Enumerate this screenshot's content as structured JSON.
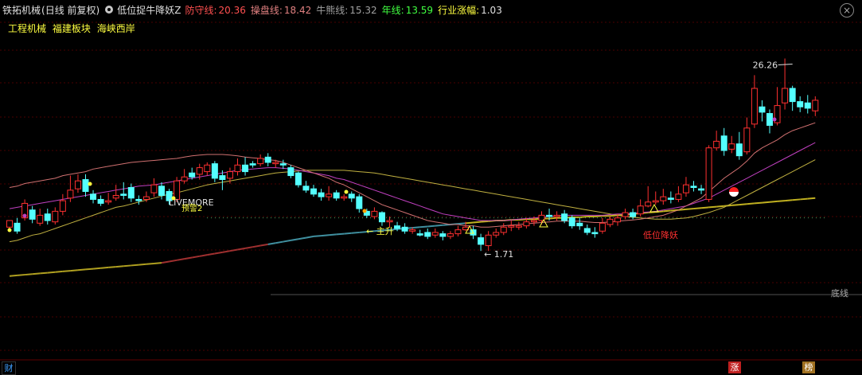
{
  "header": {
    "stock_name": "铁拓机械",
    "period": "(日线 前复权)",
    "indicator_name": "低位捉牛降妖Z",
    "items": [
      {
        "label": "防守线:",
        "value": "20.36",
        "color": "#ff5050"
      },
      {
        "label": "操盘线:",
        "value": "18.42",
        "color": "#e08080"
      },
      {
        "label": "牛熊线:",
        "value": "15.32",
        "color": "#a0a0a0"
      },
      {
        "label": "年线:",
        "value": "13.59",
        "color": "#40ff40"
      },
      {
        "label": "行业涨幅:",
        "value": "1.03",
        "color": "#ffff40"
      }
    ]
  },
  "tags": [
    "工程机械",
    "福建板块",
    "海峡西岸"
  ],
  "chart_data": {
    "type": "candlestick",
    "ylim": [
      9,
      29
    ],
    "max_label": "26.26",
    "min_label": "1.71",
    "candles": [
      [
        13.5,
        14.0,
        14.0,
        13.2
      ],
      [
        13.8,
        13.2,
        14.2,
        13.0
      ],
      [
        14.2,
        15.3,
        15.6,
        14.0
      ],
      [
        14.8,
        14.1,
        15.1,
        13.8
      ],
      [
        13.8,
        14.4,
        14.9,
        13.6
      ],
      [
        14.5,
        14.0,
        14.9,
        13.7
      ],
      [
        13.9,
        14.7,
        15.0,
        13.7
      ],
      [
        14.7,
        15.5,
        16.0,
        14.4
      ],
      [
        15.7,
        16.3,
        17.4,
        15.4
      ],
      [
        16.4,
        17.0,
        17.5,
        16.1
      ],
      [
        17.1,
        16.2,
        17.5,
        15.8
      ],
      [
        16.0,
        15.6,
        16.3,
        15.3
      ],
      [
        15.6,
        15.3,
        15.9,
        15.1
      ],
      [
        15.4,
        15.5,
        16.1,
        15.2
      ],
      [
        15.7,
        15.9,
        16.7,
        15.5
      ],
      [
        16.0,
        15.9,
        16.9,
        15.6
      ],
      [
        16.5,
        15.7,
        16.8,
        15.4
      ],
      [
        15.6,
        15.5,
        15.9,
        15.2
      ],
      [
        15.6,
        15.8,
        16.2,
        15.4
      ],
      [
        16.1,
        16.7,
        17.2,
        15.8
      ],
      [
        16.6,
        15.9,
        16.9,
        15.6
      ],
      [
        16.2,
        15.5,
        16.4,
        15.2
      ],
      [
        15.6,
        17.0,
        17.3,
        15.4
      ],
      [
        17.0,
        17.3,
        17.9,
        16.8
      ],
      [
        17.6,
        17.3,
        18.0,
        17.1
      ],
      [
        17.5,
        18.0,
        18.3,
        17.1
      ],
      [
        17.7,
        18.2,
        18.4,
        17.4
      ],
      [
        18.3,
        17.2,
        18.5,
        16.9
      ],
      [
        17.4,
        17.1,
        17.8,
        16.3
      ],
      [
        17.2,
        17.7,
        18.0,
        16.8
      ],
      [
        17.7,
        18.2,
        18.7,
        17.4
      ],
      [
        18.2,
        17.7,
        18.8,
        17.4
      ],
      [
        18.3,
        18.2,
        18.5,
        18.0
      ],
      [
        18.3,
        18.7,
        19.0,
        18.1
      ],
      [
        18.8,
        18.4,
        19.1,
        18.1
      ],
      [
        18.3,
        18.4,
        18.6,
        18.0
      ],
      [
        18.3,
        18.2,
        18.6,
        17.9
      ],
      [
        18.0,
        17.4,
        18.2,
        17.2
      ],
      [
        17.6,
        16.7,
        17.7,
        16.5
      ],
      [
        16.6,
        16.3,
        17.0,
        16.1
      ],
      [
        16.4,
        16.0,
        16.7,
        15.8
      ],
      [
        16.1,
        15.8,
        16.4,
        15.5
      ],
      [
        15.8,
        16.0,
        16.6,
        15.5
      ],
      [
        16.1,
        15.7,
        16.3,
        15.5
      ],
      [
        15.7,
        15.8,
        16.0,
        15.5
      ],
      [
        16.0,
        15.7,
        16.2,
        15.4
      ],
      [
        15.8,
        14.9,
        16.0,
        14.6
      ],
      [
        14.7,
        14.4,
        14.9,
        14.2
      ],
      [
        14.3,
        14.7,
        15.0,
        14.1
      ],
      [
        14.6,
        13.9,
        14.7,
        13.6
      ],
      [
        13.9,
        14.0,
        14.3,
        13.5
      ],
      [
        13.6,
        13.4,
        13.9,
        13.2
      ],
      [
        13.5,
        13.2,
        13.8,
        13.0
      ],
      [
        13.2,
        13.3,
        13.5,
        13.0
      ],
      [
        13.0,
        12.9,
        13.3,
        12.8
      ],
      [
        13.1,
        12.8,
        13.4,
        12.6
      ],
      [
        12.9,
        13.1,
        13.4,
        12.7
      ],
      [
        13.0,
        12.8,
        13.2,
        12.5
      ],
      [
        12.8,
        13.0,
        13.2,
        12.6
      ],
      [
        13.0,
        13.3,
        13.6,
        12.8
      ],
      [
        13.3,
        13.5,
        13.9,
        13.2
      ],
      [
        13.3,
        12.9,
        13.6,
        12.6
      ],
      [
        12.7,
        12.2,
        13.0,
        11.7
      ],
      [
        12.1,
        12.9,
        13.2,
        11.7
      ],
      [
        12.9,
        13.1,
        13.4,
        12.7
      ],
      [
        13.1,
        13.5,
        13.8,
        12.9
      ],
      [
        13.5,
        13.6,
        14.0,
        13.2
      ],
      [
        13.5,
        13.6,
        13.9,
        13.3
      ],
      [
        13.6,
        13.9,
        14.2,
        13.4
      ],
      [
        13.9,
        14.0,
        14.3,
        13.6
      ],
      [
        14.0,
        14.4,
        14.7,
        13.7
      ],
      [
        14.4,
        14.3,
        14.9,
        14.0
      ],
      [
        14.3,
        14.4,
        14.7,
        14.0
      ],
      [
        14.5,
        14.0,
        14.8,
        13.8
      ],
      [
        14.2,
        13.6,
        14.4,
        13.4
      ],
      [
        13.8,
        13.6,
        14.2,
        13.3
      ],
      [
        13.4,
        13.1,
        13.7,
        12.9
      ],
      [
        13.1,
        13.0,
        13.5,
        12.7
      ],
      [
        13.2,
        13.8,
        14.2,
        13.0
      ],
      [
        13.7,
        14.1,
        14.3,
        13.5
      ],
      [
        13.9,
        14.2,
        14.5,
        13.6
      ],
      [
        14.3,
        14.6,
        14.9,
        14.1
      ],
      [
        14.6,
        14.3,
        14.9,
        14.1
      ],
      [
        14.5,
        15.1,
        15.6,
        14.3
      ],
      [
        15.1,
        15.4,
        16.6,
        15.0
      ],
      [
        15.4,
        15.5,
        16.2,
        15.2
      ],
      [
        15.5,
        15.8,
        16.4,
        15.2
      ],
      [
        15.7,
        15.6,
        16.2,
        15.3
      ],
      [
        15.6,
        16.0,
        16.6,
        15.4
      ],
      [
        16.1,
        16.7,
        17.3,
        15.8
      ],
      [
        16.6,
        16.5,
        17.0,
        16.2
      ],
      [
        16.4,
        16.3,
        16.7,
        16.0
      ],
      [
        15.6,
        19.5,
        19.7,
        15.4
      ],
      [
        19.5,
        20.0,
        20.8,
        19.3
      ],
      [
        20.4,
        19.3,
        21.0,
        18.9
      ],
      [
        19.4,
        19.8,
        20.4,
        19.1
      ],
      [
        19.8,
        18.9,
        20.7,
        18.6
      ],
      [
        19.2,
        21.0,
        21.8,
        19.0
      ],
      [
        21.3,
        24.0,
        25.0,
        21.0
      ],
      [
        22.6,
        22.2,
        23.1,
        21.5
      ],
      [
        22.1,
        21.2,
        22.4,
        20.6
      ],
      [
        21.4,
        22.7,
        24.1,
        21.2
      ],
      [
        22.9,
        24.0,
        26.26,
        22.4
      ],
      [
        24.0,
        23.0,
        24.2,
        22.3
      ],
      [
        23.0,
        22.6,
        23.4,
        22.2
      ],
      [
        22.9,
        22.5,
        23.5,
        22.1
      ],
      [
        22.3,
        23.1,
        23.4,
        21.9
      ]
    ],
    "ma_defense": [
      16.5,
      16.6,
      16.8,
      16.9,
      17.0,
      17.1,
      17.2,
      17.4,
      17.5,
      17.6,
      17.7,
      17.9,
      18.0,
      18.1,
      18.2,
      18.3,
      18.4,
      18.45,
      18.5,
      18.55,
      18.6,
      18.65,
      18.7,
      18.8,
      18.9,
      18.95,
      19.0,
      19.0,
      19.0,
      18.95,
      18.9,
      18.8,
      18.75,
      18.7,
      18.6,
      18.55,
      18.4,
      18.2,
      18.0,
      17.8,
      17.6,
      17.4,
      17.2,
      16.9,
      16.7,
      16.4,
      16.1,
      15.8,
      15.5,
      15.2,
      15.0,
      14.8,
      14.6,
      14.4,
      14.2,
      14.0,
      13.9,
      13.8,
      13.7,
      13.7,
      13.6,
      13.6,
      13.5,
      13.5,
      13.55,
      13.6,
      13.65,
      13.7,
      13.75,
      13.8,
      13.85,
      13.9,
      13.95,
      13.95,
      13.95,
      13.95,
      13.9,
      13.85,
      13.85,
      13.9,
      13.95,
      14.0,
      14.05,
      14.1,
      14.2,
      14.3,
      14.4,
      14.6,
      14.8,
      15.1,
      15.4,
      15.7,
      16.2,
      16.7,
      17.2,
      17.6,
      18.0,
      18.5,
      19.1,
      19.5,
      19.8,
      20.1,
      20.5,
      20.8,
      21.0,
      21.2,
      21.4
    ],
    "ma_operate": [
      14.9,
      15.0,
      15.1,
      15.2,
      15.3,
      15.4,
      15.5,
      15.6,
      15.7,
      15.8,
      15.9,
      16.0,
      16.1,
      16.2,
      16.3,
      16.4,
      16.5,
      16.6,
      16.65,
      16.7,
      16.8,
      16.9,
      17.0,
      17.1,
      17.2,
      17.3,
      17.4,
      17.5,
      17.6,
      17.7,
      17.8,
      17.85,
      17.9,
      17.95,
      18.0,
      18.0,
      17.95,
      17.9,
      17.8,
      17.7,
      17.6,
      17.5,
      17.4,
      17.2,
      17.1,
      16.9,
      16.7,
      16.5,
      16.3,
      16.1,
      15.9,
      15.7,
      15.5,
      15.3,
      15.1,
      14.9,
      14.7,
      14.5,
      14.4,
      14.3,
      14.2,
      14.1,
      14.0,
      14.0,
      14.0,
      14.0,
      14.05,
      14.1,
      14.15,
      14.2,
      14.25,
      14.3,
      14.35,
      14.4,
      14.4,
      14.4,
      14.4,
      14.4,
      14.4,
      14.45,
      14.5,
      14.5,
      14.55,
      14.6,
      14.65,
      14.7,
      14.8,
      14.9,
      15.0,
      15.1,
      15.3,
      15.5,
      15.7,
      16.0,
      16.3,
      16.6,
      16.9,
      17.2,
      17.5,
      17.8,
      18.1,
      18.4,
      18.7,
      19.0,
      19.3,
      19.6,
      19.9
    ],
    "ma_bull": [
      12.4,
      12.5,
      12.7,
      12.9,
      13.0,
      13.2,
      13.4,
      13.6,
      13.8,
      14.0,
      14.2,
      14.4,
      14.6,
      14.8,
      15.0,
      15.1,
      15.25,
      15.4,
      15.55,
      15.7,
      15.85,
      16.0,
      16.1,
      16.25,
      16.4,
      16.55,
      16.7,
      16.8,
      16.9,
      17.0,
      17.1,
      17.2,
      17.3,
      17.4,
      17.5,
      17.6,
      17.65,
      17.7,
      17.75,
      17.8,
      17.8,
      17.8,
      17.8,
      17.8,
      17.8,
      17.75,
      17.7,
      17.65,
      17.6,
      17.5,
      17.4,
      17.3,
      17.2,
      17.1,
      17.0,
      16.9,
      16.8,
      16.7,
      16.6,
      16.5,
      16.4,
      16.3,
      16.2,
      16.1,
      16.0,
      15.9,
      15.8,
      15.7,
      15.6,
      15.5,
      15.4,
      15.3,
      15.2,
      15.1,
      15.0,
      14.9,
      14.8,
      14.7,
      14.6,
      14.5,
      14.4,
      14.3,
      14.25,
      14.2,
      14.15,
      14.1,
      14.1,
      14.1,
      14.15,
      14.2,
      14.3,
      14.45,
      14.6,
      14.8,
      15.0,
      15.3,
      15.6,
      15.9,
      16.2,
      16.5,
      16.8,
      17.1,
      17.4,
      17.7,
      18.0,
      18.3,
      18.6
    ],
    "year_line": [
      9.8,
      9.85,
      9.9,
      9.95,
      10.0,
      10.05,
      10.1,
      10.15,
      10.2,
      10.25,
      10.3,
      10.35,
      10.4,
      10.45,
      10.5,
      10.55,
      10.6,
      10.65,
      10.7,
      10.75,
      10.8,
      10.9,
      11.0,
      11.1,
      11.2,
      11.3,
      11.4,
      11.5,
      11.6,
      11.7,
      11.8,
      11.9,
      12.0,
      12.1,
      12.2,
      12.3,
      12.4,
      12.5,
      12.6,
      12.7,
      12.8,
      12.85,
      12.9,
      12.95,
      13.0,
      13.05,
      13.1,
      13.15,
      13.2,
      13.25,
      13.3,
      13.35,
      13.4,
      13.45,
      13.5,
      13.55,
      13.6,
      13.65,
      13.7,
      13.75,
      13.8,
      13.85,
      13.9,
      13.95,
      14.0,
      14.0,
      14.05,
      14.05,
      14.1,
      14.1,
      14.15,
      14.15,
      14.2,
      14.2,
      14.25,
      14.25,
      14.3,
      14.3,
      14.35,
      14.35,
      14.4,
      14.45,
      14.5,
      14.55,
      14.6,
      14.65,
      14.7,
      14.75,
      14.8,
      14.85,
      14.9,
      14.95,
      15.0,
      15.05,
      15.1,
      15.15,
      15.2,
      15.25,
      15.3,
      15.35,
      15.4,
      15.45,
      15.5,
      15.55,
      15.6,
      15.65,
      15.7
    ],
    "ref_level": 14.2,
    "annotations": {
      "livemore": "LIVEMORE",
      "warning": "预警2",
      "main_rise": "主升",
      "low_demon": "低位降妖",
      "bottom_line": "底线"
    }
  },
  "footer": {
    "left": "财",
    "rise": "涨",
    "rank": "榜"
  }
}
